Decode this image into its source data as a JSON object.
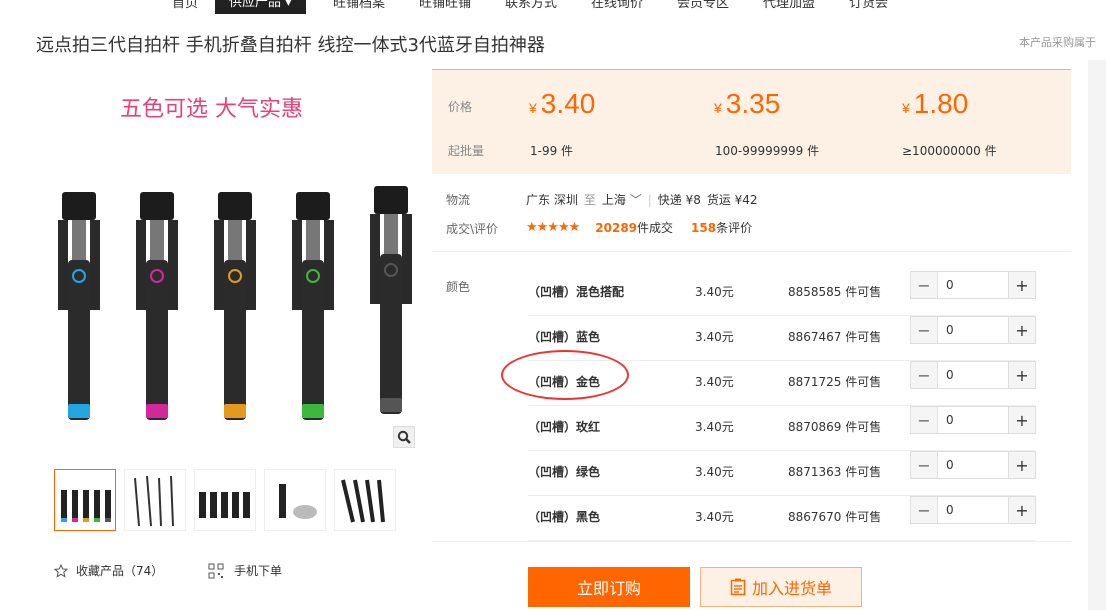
{
  "nav": {
    "items": [
      "首页",
      "供应产品",
      "旺铺档案",
      "旺铺旺铺",
      "联系方式",
      "在线询价",
      "会员专区",
      "代理加盟",
      "订货会"
    ],
    "active_index": 1
  },
  "product": {
    "title": "远点拍三代自拍杆 手机折叠自拍杆 线控一体式3代蓝牙自拍神器",
    "right_note": "本产品采购属于"
  },
  "image": {
    "banner_text": "五色可选 大气实惠",
    "stick_colors": [
      "#22a7e0",
      "#d2289b",
      "#e59a1e",
      "#3cb93c",
      "#555555"
    ]
  },
  "favorite": {
    "label": "收藏产品（74）"
  },
  "mobile_order": {
    "label": "手机下单"
  },
  "pricing": {
    "price_label": "价格",
    "min_label": "起批量",
    "currency": "¥",
    "tiers": [
      {
        "price": "3.40",
        "range": "1-99 件"
      },
      {
        "price": "3.35",
        "range": "100-99999999 件"
      },
      {
        "price": "1.80",
        "range": "≥100000000 件"
      }
    ]
  },
  "logistics": {
    "label": "物流",
    "from": "广东 深圳",
    "to_word": "至",
    "to": "上海",
    "express": "快递 ¥8",
    "freight": "货运 ¥42"
  },
  "deals": {
    "label": "成交\\评价",
    "stars": "★★★★★",
    "deal_count": "20289",
    "deal_suffix": "件成交",
    "review_count": "158",
    "review_suffix": "条评价"
  },
  "colors": {
    "label": "颜色",
    "items": [
      {
        "name": "（凹槽）混色搭配",
        "price": "3.40元",
        "stock": "8858585 件可售",
        "qty": "0"
      },
      {
        "name": "（凹槽）蓝色",
        "price": "3.40元",
        "stock": "8867467 件可售",
        "qty": "0"
      },
      {
        "name": "（凹槽）金色",
        "price": "3.40元",
        "stock": "8871725 件可售",
        "qty": "0"
      },
      {
        "name": "（凹槽）玫红",
        "price": "3.40元",
        "stock": "8870869 件可售",
        "qty": "0"
      },
      {
        "name": "（凹槽）绿色",
        "price": "3.40元",
        "stock": "8871363 件可售",
        "qty": "0"
      },
      {
        "name": "（凹槽）黑色",
        "price": "3.40元",
        "stock": "8867670 件可售",
        "qty": "0"
      }
    ]
  },
  "actions": {
    "buy_label": "立即订购",
    "cart_label": "加入进货单"
  }
}
